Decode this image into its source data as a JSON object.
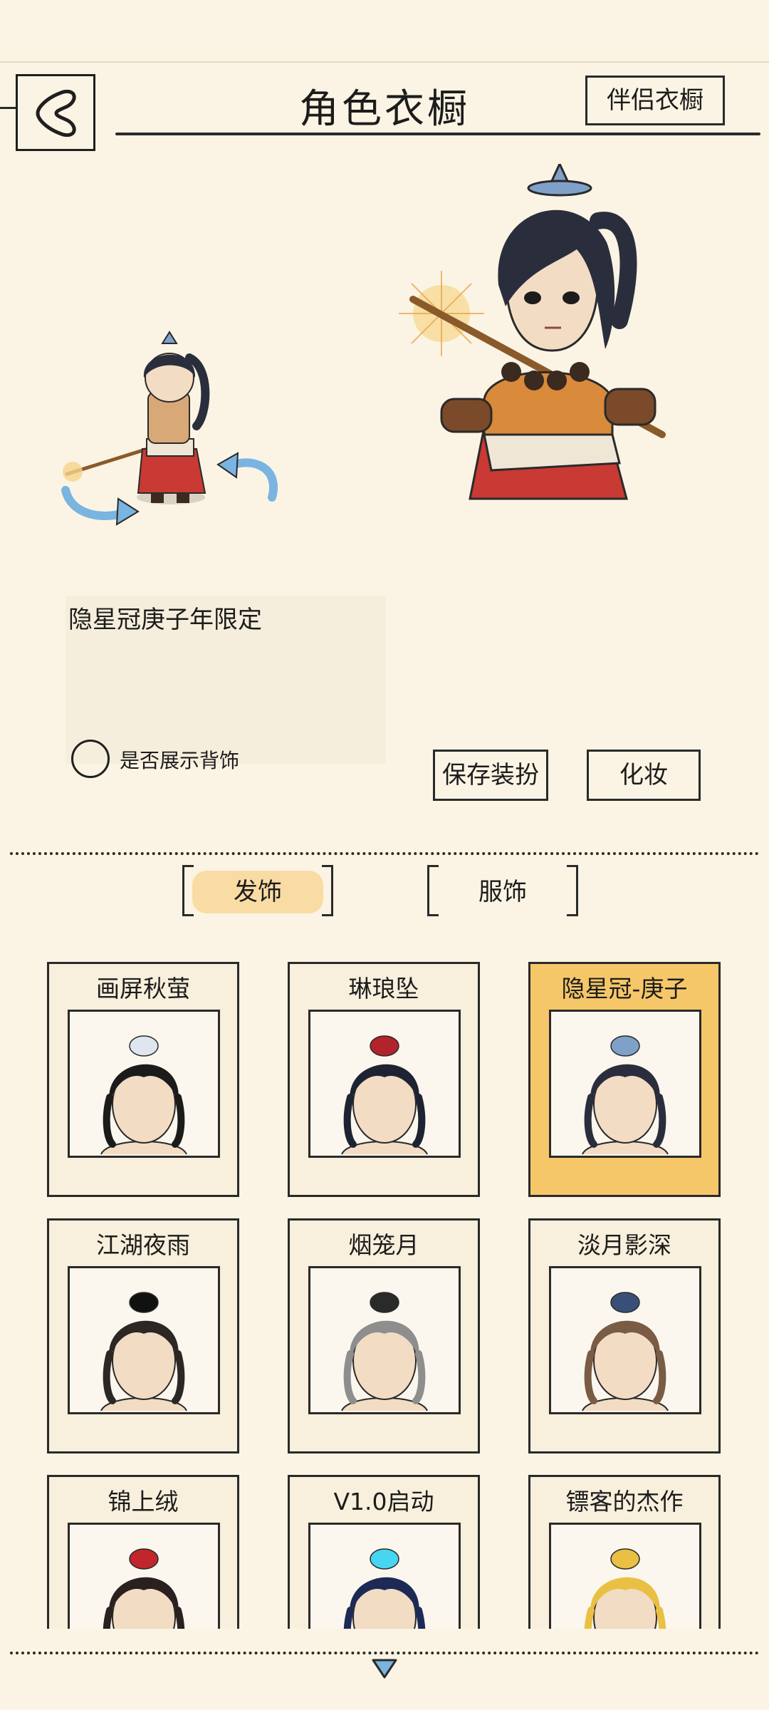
{
  "header": {
    "title": "角色衣橱",
    "companion_button": "伴侣衣橱"
  },
  "preview": {
    "item_name": "隐星冠庚子年限定",
    "show_back_accessory_label": "是否展示背饰",
    "save_button": "保存装扮",
    "makeup_button": "化妆"
  },
  "tabs": [
    {
      "label": "发饰",
      "active": true
    },
    {
      "label": "服饰",
      "active": false
    }
  ],
  "items": [
    {
      "name": "画屏秋萤",
      "selected": false,
      "hair_color": "#1b1b1b",
      "accent": "#dfe6ef"
    },
    {
      "name": "琳琅坠",
      "selected": false,
      "hair_color": "#1e2333",
      "accent": "#b3232b"
    },
    {
      "name": "隐星冠-庚子",
      "selected": true,
      "hair_color": "#2a2e3c",
      "accent": "#7fa0c9"
    },
    {
      "name": "江湖夜雨",
      "selected": false,
      "hair_color": "#2b2723",
      "accent": "#111111"
    },
    {
      "name": "烟笼月",
      "selected": false,
      "hair_color": "#8e8e8e",
      "accent": "#2a2a2a"
    },
    {
      "name": "淡月影深",
      "selected": false,
      "hair_color": "#7a5b43",
      "accent": "#3a4f78"
    },
    {
      "name": "锦上绒",
      "selected": false,
      "hair_color": "#2a2020",
      "accent": "#c0262c"
    },
    {
      "name": "V1.0启动",
      "selected": false,
      "hair_color": "#1d2a55",
      "accent": "#48d5f0"
    },
    {
      "name": "镖客的杰作",
      "selected": false,
      "hair_color": "#e9c043",
      "accent": "#e9c043"
    }
  ],
  "colors": {
    "background": "#fbf4e4",
    "selected_card": "#f6c768",
    "active_tab": "#f9dca4",
    "ink": "#2a2a2a"
  }
}
